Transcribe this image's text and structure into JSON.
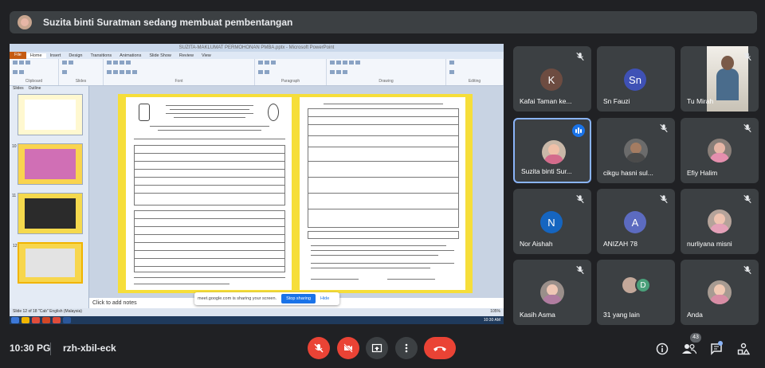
{
  "banner": {
    "text": "Suzita binti Suratman sedang membuat pembentangan"
  },
  "presentation": {
    "window_title": "SUZITA-MAKLUMAT PERMOHONAN PMBA.pptx - Microsoft PowerPoint",
    "ribbon_tabs": [
      "File",
      "Home",
      "Insert",
      "Design",
      "Transitions",
      "Animations",
      "Slide Show",
      "Review",
      "View"
    ],
    "ribbon_groups": [
      "Clipboard",
      "Slides",
      "Font",
      "Paragraph",
      "Drawing",
      "Editing"
    ],
    "pane_tabs": [
      "Slides",
      "Outline"
    ],
    "slide_numbers": [
      "",
      "10",
      "11",
      "12"
    ],
    "notes_placeholder": "Click to add notes",
    "status_left": "Slide 12 of 18   \"Cab\"   English (Malaysia)",
    "zoom": "105%",
    "share_message": "meet.google.com is sharing your screen.",
    "stop_label": "Stop sharing",
    "hide_label": "Hide",
    "taskbar_clock": "10:30 AM"
  },
  "participants": [
    {
      "name": "Kafai Taman ke...",
      "initial": "K",
      "color": "#6d4c41",
      "type": "initial",
      "muted": true
    },
    {
      "name": "Sn Fauzi",
      "initial": "Sn",
      "color": "#3f51b5",
      "type": "initial",
      "muted": false
    },
    {
      "name": "Tu Mirah",
      "type": "video",
      "muted": true
    },
    {
      "name": "Suzita binti Sur...",
      "type": "photo",
      "muted": false,
      "speaking": true
    },
    {
      "name": "cikgu hasni sul...",
      "type": "photo",
      "muted": true
    },
    {
      "name": "Efiy Halim",
      "type": "photo",
      "muted": true
    },
    {
      "name": "Nor Aishah",
      "initial": "N",
      "color": "#1565c0",
      "type": "initial",
      "muted": true
    },
    {
      "name": "ANIZAH 78",
      "initial": "A",
      "color": "#5c6bc0",
      "type": "initial",
      "muted": true
    },
    {
      "name": "nurliyana misni",
      "type": "photo",
      "muted": true
    },
    {
      "name": "Kasih Asma",
      "type": "photo",
      "muted": true
    },
    {
      "name": "31 yang lain",
      "type": "multi",
      "muted": false,
      "initial": "D"
    },
    {
      "name": "Anda",
      "type": "photo",
      "muted": true
    }
  ],
  "bottom": {
    "time": "10:30 PG",
    "meeting_code": "rzh-xbil-eck",
    "people_count": "43"
  },
  "colors": {
    "end_call": "#ea4335",
    "tile_bg": "#3c4043",
    "bg": "#202124",
    "accent": "#8ab4f8"
  }
}
